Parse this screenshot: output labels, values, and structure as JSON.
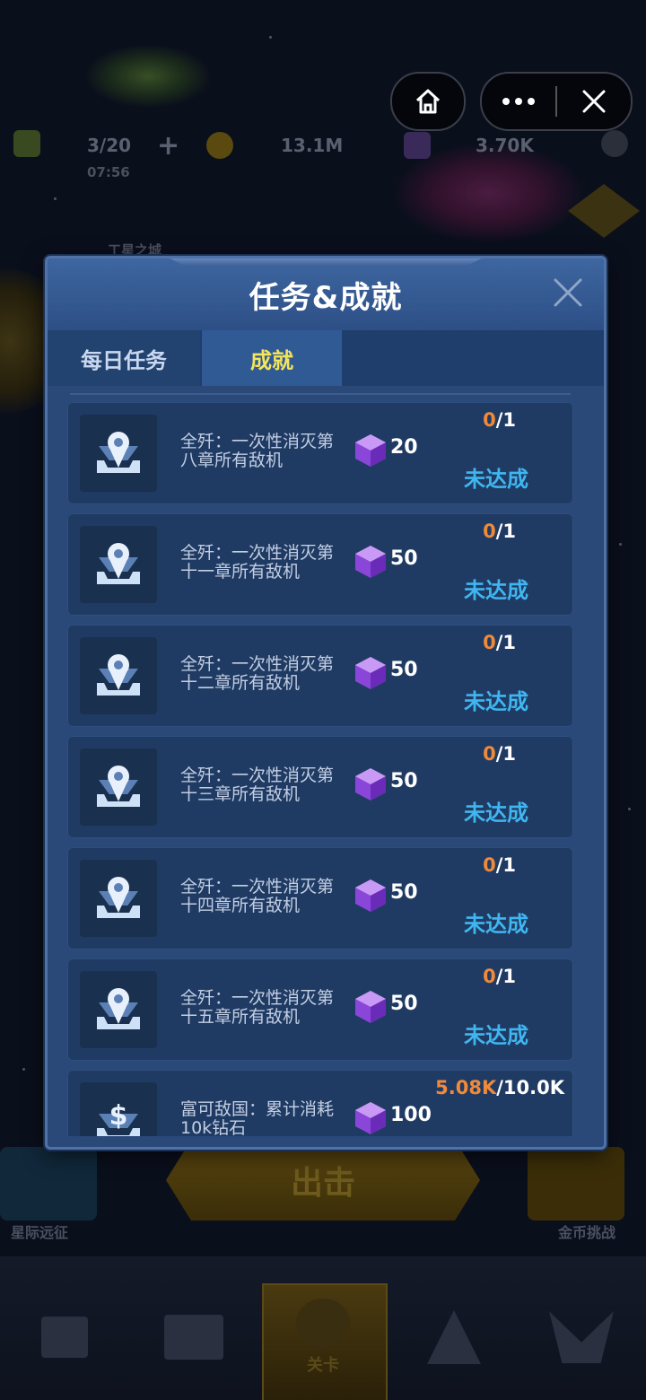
{
  "hud": {
    "energy": "3/20",
    "energy_timer": "07:56",
    "coins": "13.1M",
    "gems": "3.70K",
    "location_label": "工星之城"
  },
  "top_buttons": {
    "home_icon": "home-icon",
    "more_icon": "more-dots-icon",
    "close_icon": "close-icon"
  },
  "modal": {
    "title": "任务&成就",
    "tabs": [
      {
        "label": "每日任务",
        "active": false
      },
      {
        "label": "成就",
        "active": true
      }
    ],
    "items": [
      {
        "desc": "全歼：一次性消灭第八章所有敌机",
        "reward": "20",
        "current": "0",
        "total": "/1",
        "status": "未达成",
        "icon": "location-pin-icon"
      },
      {
        "desc": "全歼：一次性消灭第十一章所有敌机",
        "reward": "50",
        "current": "0",
        "total": "/1",
        "status": "未达成",
        "icon": "location-pin-icon"
      },
      {
        "desc": "全歼：一次性消灭第十二章所有敌机",
        "reward": "50",
        "current": "0",
        "total": "/1",
        "status": "未达成",
        "icon": "location-pin-icon"
      },
      {
        "desc": "全歼：一次性消灭第十三章所有敌机",
        "reward": "50",
        "current": "0",
        "total": "/1",
        "status": "未达成",
        "icon": "location-pin-icon"
      },
      {
        "desc": "全歼：一次性消灭第十四章所有敌机",
        "reward": "50",
        "current": "0",
        "total": "/1",
        "status": "未达成",
        "icon": "location-pin-icon"
      },
      {
        "desc": "全歼：一次性消灭第十五章所有敌机",
        "reward": "50",
        "current": "0",
        "total": "/1",
        "status": "未达成",
        "icon": "location-pin-icon"
      },
      {
        "desc": "富可敌国：累计消耗10k钻石",
        "reward": "100",
        "current": "5.08K",
        "total": "/10.0K",
        "status": "",
        "icon": "dollar-icon"
      }
    ]
  },
  "background": {
    "start_button": "出击",
    "left_card_label": "星际远征",
    "right_card_label": "金币挑战",
    "active_tab_label": "关卡"
  },
  "colors": {
    "modal_bg": "#2a4878",
    "progress_current": "#f08a3a",
    "status_text": "#3fb6f0",
    "active_tab_text": "#f6e45a"
  }
}
